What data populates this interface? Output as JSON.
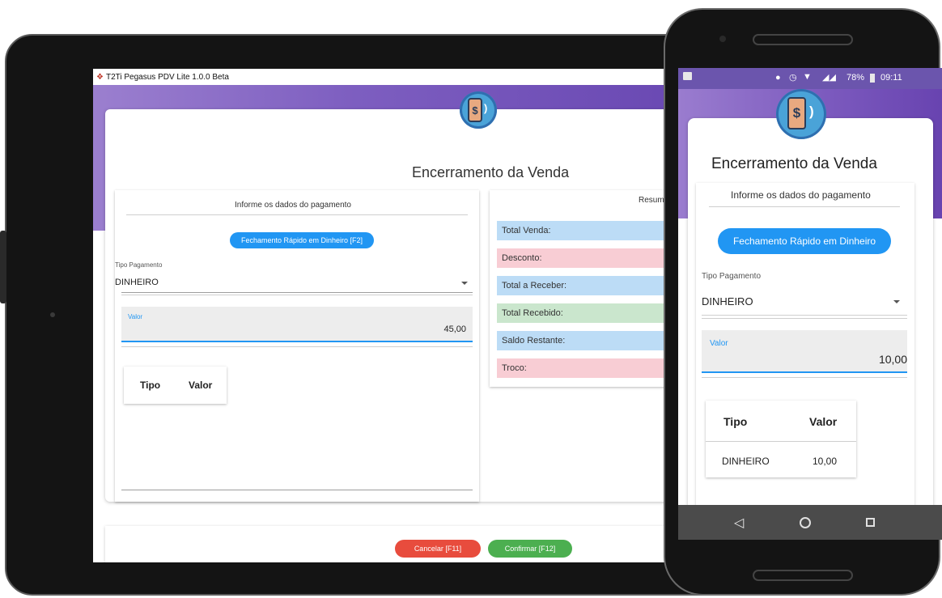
{
  "tablet": {
    "window_title": "T2Ti Pegasus PDV Lite 1.0.0 Beta",
    "page_title": "Encerramento da Venda",
    "payment_section_title": "Informe os dados do pagamento",
    "summary_section_title": "Resum",
    "quick_close_button": "Fechamento Rápido em Dinheiro [F2]",
    "payment_type_label": "Tipo Pagamento",
    "payment_type_value": "DINHEIRO",
    "value_label": "Valor",
    "value_amount": "45,00",
    "table_headers": [
      "Tipo",
      "Valor"
    ],
    "summary_rows": [
      {
        "label": "Total Venda:",
        "color": "#bcdcf6"
      },
      {
        "label": "Desconto:",
        "color": "#f8cdd4"
      },
      {
        "label": "Total a Receber:",
        "color": "#bcdcf6"
      },
      {
        "label": "Total Recebido:",
        "color": "#cae6cd"
      },
      {
        "label": "Saldo Restante:",
        "color": "#bcdcf6"
      },
      {
        "label": "Troco:",
        "color": "#f8cdd4"
      }
    ],
    "cancel_button": "Cancelar [F11]",
    "confirm_button": "Confirmar [F12]",
    "logo_symbol": "$"
  },
  "phone": {
    "status": {
      "battery": "78%",
      "time": "09:11"
    },
    "page_title": "Encerramento da Venda",
    "payment_section_title": "Informe os dados do pagamento",
    "quick_close_button": "Fechamento Rápido em Dinheiro",
    "payment_type_label": "Tipo Pagamento",
    "payment_type_value": "DINHEIRO",
    "value_label": "Valor",
    "value_amount": "10,00",
    "table_headers": [
      "Tipo",
      "Valor"
    ],
    "table_rows": [
      [
        "DINHEIRO",
        "10,00"
      ]
    ],
    "logo_symbol": "$"
  },
  "colors": {
    "accent": "#2196f3",
    "purple": "#7d5ec0",
    "cancel": "#e84c3d",
    "confirm": "#4caf50"
  },
  "icons": [
    "app-icon",
    "dropdown-caret-icon",
    "payment-logo-icon",
    "back-nav-icon",
    "home-nav-icon",
    "recents-nav-icon",
    "wifi-icon",
    "signal-icon",
    "battery-icon"
  ]
}
